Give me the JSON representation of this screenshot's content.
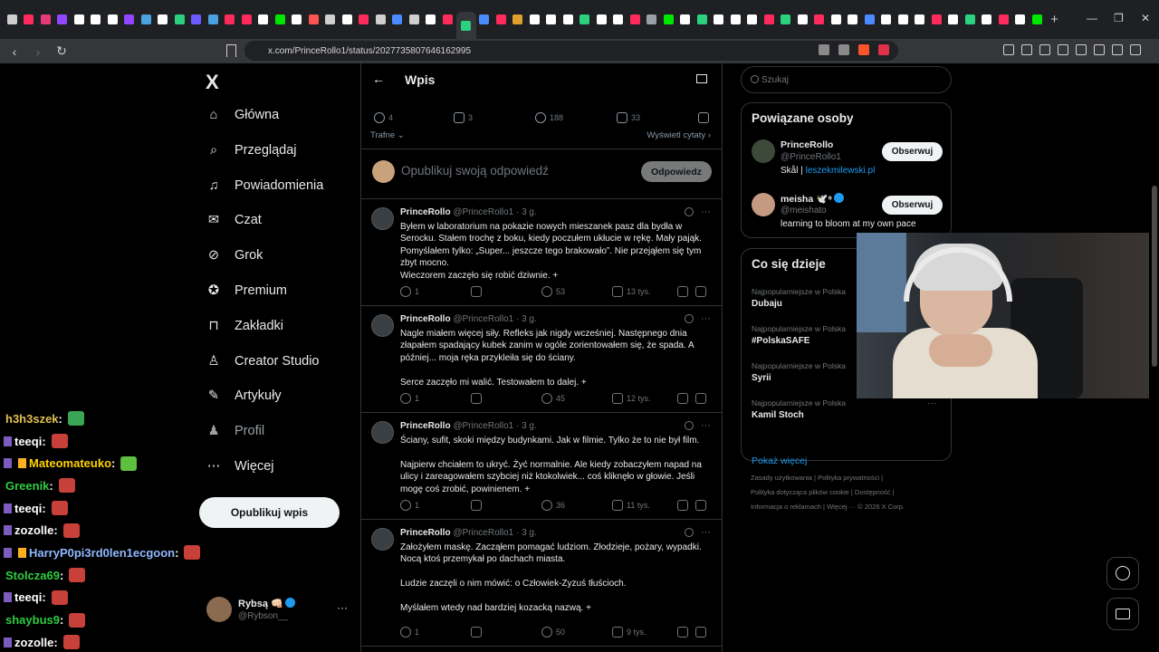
{
  "browser": {
    "url": "x.com/PrinceRollo1/status/2027735807646162995",
    "tab_favicon_colors": [
      "#cfcfcf",
      "#ff2b5c",
      "#e63b7a",
      "#9146ff",
      "#ffffff",
      "#ffffff",
      "#ffffff",
      "#9146ff",
      "#4aa3df",
      "#ffffff",
      "#2bd17e",
      "#6b5cff",
      "#4aa3df",
      "#ff2b5c",
      "#ff2b5c",
      "#ffffff",
      "#00e701",
      "#ffffff",
      "#ff5252",
      "#cfcfcf",
      "#ffffff",
      "#ff2b5c",
      "#cfcfcf",
      "#4a8cff",
      "#cfcfcf",
      "#ffffff",
      "#ff2b5c",
      "#2bd17e",
      "#4a8cff",
      "#ff2b5c",
      "#e0a030",
      "#ffffff",
      "#ffffff",
      "#ffffff",
      "#2bd17e",
      "#ffffff",
      "#ffffff",
      "#ff2b5c",
      "#9aa0a6",
      "#00e701",
      "#ffffff",
      "#2bd17e",
      "#ffffff",
      "#ffffff",
      "#ffffff",
      "#ff2b5c",
      "#2bd17e",
      "#ffffff",
      "#ff2b5c",
      "#ffffff",
      "#ffffff",
      "#4a8cff",
      "#ffffff",
      "#ffffff",
      "#ffffff",
      "#ff2b5c",
      "#ffffff",
      "#2bd17e",
      "#ffffff",
      "#ff2b5c",
      "#ffffff",
      "#00e701"
    ],
    "new_tab": "+",
    "window_controls": [
      "—",
      "❐",
      "✕"
    ],
    "nav": [
      "‹",
      "›",
      "↻"
    ]
  },
  "sidebar": {
    "logo": "X",
    "items": [
      {
        "label": "Główna",
        "icon": "home-icon",
        "glyph": "⌂"
      },
      {
        "label": "Przeglądaj",
        "icon": "search-icon",
        "glyph": "⌕"
      },
      {
        "label": "Powiadomienia",
        "icon": "bell-icon",
        "glyph": "♫"
      },
      {
        "label": "Czat",
        "icon": "mail-icon",
        "glyph": "✉"
      },
      {
        "label": "Grok",
        "icon": "grok-icon",
        "glyph": "⊘"
      },
      {
        "label": "Premium",
        "icon": "premium-icon",
        "glyph": "✪"
      },
      {
        "label": "Zakładki",
        "icon": "bookmark-icon",
        "glyph": "⊓"
      },
      {
        "label": "Creator Studio",
        "icon": "creator-icon",
        "glyph": "♙"
      },
      {
        "label": "Artykuły",
        "icon": "articles-icon",
        "glyph": "✎"
      },
      {
        "label": "Profil",
        "icon": "profile-icon",
        "glyph": "♟"
      },
      {
        "label": "Więcej",
        "icon": "more-icon",
        "glyph": "⋯"
      }
    ],
    "post_button": "Opublikuj wpis",
    "user": {
      "name": "Rybsą 👊🏻",
      "handle": "@Rybson__",
      "more": "···"
    }
  },
  "chat": [
    {
      "user": "h3h3szek",
      "color": "#e0c050",
      "badges": 0
    },
    {
      "user": "teeqi",
      "color": "#ffffff",
      "badges": 1
    },
    {
      "user": "Mateomateuko",
      "color": "#ffd200",
      "badges": 2
    },
    {
      "user": "Greenik",
      "color": "#2ecc40",
      "badges": 0
    },
    {
      "user": "teeqi",
      "color": "#ffffff",
      "badges": 1
    },
    {
      "user": "zozolle",
      "color": "#ffffff",
      "badges": 1
    },
    {
      "user": "HarryP0pi3rd0len1ecgoon",
      "color": "#8fb8ff",
      "badges": 2
    },
    {
      "user": "Stolcza69",
      "color": "#2ecc40",
      "badges": 0
    },
    {
      "user": "teeqi",
      "color": "#ffffff",
      "badges": 1
    },
    {
      "user": "shaybus9",
      "color": "#2ecc40",
      "badges": 0
    },
    {
      "user": "zozolle",
      "color": "#ffffff",
      "badges": 1
    }
  ],
  "center": {
    "title": "Wpis",
    "main_actions": {
      "replies": "4",
      "reposts": "3",
      "likes": "188",
      "bookmarks": "33"
    },
    "sort_label": "Trafne",
    "quotes_link": "Wyświetl cytaty",
    "reply_placeholder": "Opublikuj swoją odpowiedź",
    "reply_button": "Odpowiedz",
    "tweets": [
      {
        "name": "PrinceRollo",
        "meta": "@PrinceRollo1 · 3 g.",
        "lines": [
          "Byłem w laboratorium na pokazie nowych mieszanek pasz dla bydła w",
          "Serocku. Stałem trochę z boku, kiedy poczułem ukłucie w rękę. Mały pająk.",
          "Pomyślałem tylko: „Super... jeszcze tego brakowało”. Nie przejąłem się tym",
          "zbyt mocno.",
          "Wieczorem zaczęło się robić dziwnie. +"
        ],
        "replies": "1",
        "likes": "53",
        "views": "13 tys."
      },
      {
        "name": "PrinceRollo",
        "meta": "@PrinceRollo1 · 3 g.",
        "lines": [
          "Nagle miałem więcej siły. Refleks jak nigdy wcześniej. Następnego dnia",
          "złapałem spadający kubek zanim w ogóle zorientowałem się, że spada. A",
          "później... moja ręka przykleiła się do ściany.",
          "",
          "Serce zaczęło mi walić. Testowałem to dalej. +"
        ],
        "replies": "1",
        "likes": "45",
        "views": "12 tys."
      },
      {
        "name": "PrinceRollo",
        "meta": "@PrinceRollo1 · 3 g.",
        "lines": [
          "Ściany, sufit, skoki między budynkami. Jak w filmie. Tylko że to nie był film.",
          "",
          "Najpierw chciałem to ukryć. Żyć normalnie. Ale kiedy zobaczyłem napad na",
          "ulicy i zareagowałem szybciej niż ktokolwiek... coś kliknęło w głowie. Jeśli",
          "mogę coś zrobić, powinienem. +"
        ],
        "replies": "1",
        "likes": "36",
        "views": "11 tys."
      },
      {
        "name": "PrinceRollo",
        "meta": "@PrinceRollo1 · 3 g.",
        "lines": [
          "Założyłem maskę. Zacząłem pomagać ludziom. Złodzieje, pożary, wypadki.",
          "Nocą ktoś przemykał po dachach miasta.",
          "",
          "Ludzie zaczęli o nim mówić: o Człowiek-Zyzuś tłuścioch.",
          "",
          "Myślałem wtedy nad bardziej kozacką nazwą. +"
        ],
        "replies": "1",
        "likes": "50",
        "views": "9 tys."
      }
    ]
  },
  "right": {
    "search_placeholder": "Szukaj",
    "related": {
      "title": "Powiązane osoby",
      "people": [
        {
          "name": "PrinceRollo",
          "handle": "@PrinceRollo1",
          "bio_prefix": "Skål | ",
          "bio_link": "leszekmilewski.pl",
          "follow": "Obserwuj"
        },
        {
          "name": "meisha 🕊️⁹",
          "handle": "@meishato",
          "bio_prefix": "learning to bloom at my own pace",
          "bio_link": "",
          "follow": "Obserwuj"
        }
      ]
    },
    "trends": {
      "title": "Co się dzieje",
      "items": [
        {
          "context": "Najpopularniejsze w Polska",
          "name": "Dubaju"
        },
        {
          "context": "Najpopularniejsze w Polska",
          "name": "#PolskaSAFE"
        },
        {
          "context": "Najpopularniejsze w Polska",
          "name": "Syrii"
        },
        {
          "context": "Najpopularniejsze w Polska",
          "name": "Kamil Stoch"
        }
      ],
      "show_more": "Pokaż więcej",
      "more": "···"
    },
    "footer": {
      "line1": "Zasady użytkowania  |  Polityka prywatności  |",
      "line2": "Polityka dotycząca plików cookie  |  Dostępność  |",
      "line3": "Informacja o reklamach  |  Więcej ···  © 2026 X Corp."
    }
  }
}
